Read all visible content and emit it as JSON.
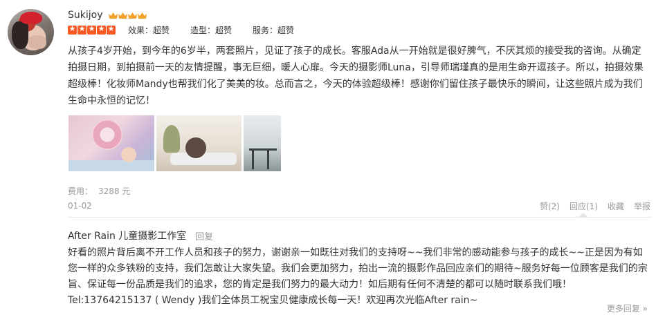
{
  "reviewer": {
    "name": "Sukijoy",
    "crown_count": 4,
    "rating_stars": 5
  },
  "scores": {
    "effect": "效果：超赞",
    "style": "造型：超赞",
    "service": "服务：超赞"
  },
  "review_text": "从孩子4岁开始，到今年的6岁半，两套照片，见证了孩子的成长。客服Ada从一开始就是很好脾气，不厌其烦的接受我的咨询。从确定拍摄日期，到拍摄前一天的友情提醒，事无巨细，暖人心扉。今天的摄影师Luna，引导师瑞瑾真的是用生命开逗孩子。所以，拍摄效果超级棒！化妆师Mandy也帮我们化了美美的妆。总而言之，今天的体验超级棒！感谢你们留住孩子最快乐的瞬间，让这些照片成为我们生命中永恒的记忆！",
  "photos": [
    "photo-1",
    "photo-2",
    "photo-3"
  ],
  "fee": {
    "label": "费用：",
    "value": "3288 元"
  },
  "date": "01-02",
  "actions": {
    "like": "赞(2)",
    "reply": "回应(1)",
    "favorite": "收藏",
    "report": "举报"
  },
  "merchant_reply": {
    "name": "After Rain 儿童摄影工作室",
    "tag": "回复",
    "text": "好看的照片背后离不开工作人员和孩子的努力，谢谢亲一如既往对我们的支持呀~~我们非常的感动能参与孩子的成长~~正是因为有如您一样的众多铁粉的支持，我们怎敢让大家失望。我们会更加努力，拍出一流的摄影作品回应亲们的期待~服务好每一位顾客是我们的宗旨、保证每一份品质是我们的追求，您的肯定是我们努力的最大动力！如后期有任何不清楚的都可以随时联系我们哦！Tel:13764215137 ( Wendy )我们全体员工祝宝贝健康成长每一天！欢迎再次光临After rain~"
  },
  "more_replies": "更多回复 »",
  "colors": {
    "star": "#f55a26",
    "crown": "#f2a12b",
    "muted": "#999999"
  }
}
